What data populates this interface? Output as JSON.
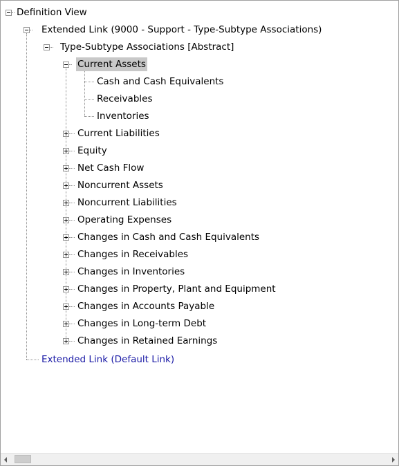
{
  "tree": {
    "root": {
      "label": "Definition View",
      "expanded": true
    },
    "extended_link_9000": {
      "label": "Extended Link (9000 - Support - Type-Subtype Associations)",
      "expanded": true
    },
    "type_subtype": {
      "label": "Type-Subtype Associations [Abstract]",
      "expanded": true
    },
    "current_assets": {
      "label": "Current Assets",
      "selected": true,
      "expanded": true,
      "children": [
        {
          "label": "Cash and Cash Equivalents"
        },
        {
          "label": "Receivables"
        },
        {
          "label": "Inventories"
        }
      ]
    },
    "collapsed_items": [
      {
        "label": "Current Liabilities"
      },
      {
        "label": "Equity"
      },
      {
        "label": "Net Cash Flow"
      },
      {
        "label": "Noncurrent Assets"
      },
      {
        "label": "Noncurrent Liabilities"
      },
      {
        "label": "Operating Expenses"
      },
      {
        "label": "Changes in Cash and Cash Equivalents"
      },
      {
        "label": "Changes in Receivables"
      },
      {
        "label": "Changes in Inventories"
      },
      {
        "label": "Changes in Property, Plant and Equipment"
      },
      {
        "label": "Changes in Accounts Payable"
      },
      {
        "label": "Changes in Long-term Debt"
      },
      {
        "label": "Changes in Retained Earnings"
      }
    ],
    "extended_link_default": {
      "label": "Extended Link (Default Link)"
    }
  },
  "colors": {
    "selection": "#c8c8c8",
    "link_text": "#1a1aa6",
    "tree_lines": "#8c8c8c"
  }
}
